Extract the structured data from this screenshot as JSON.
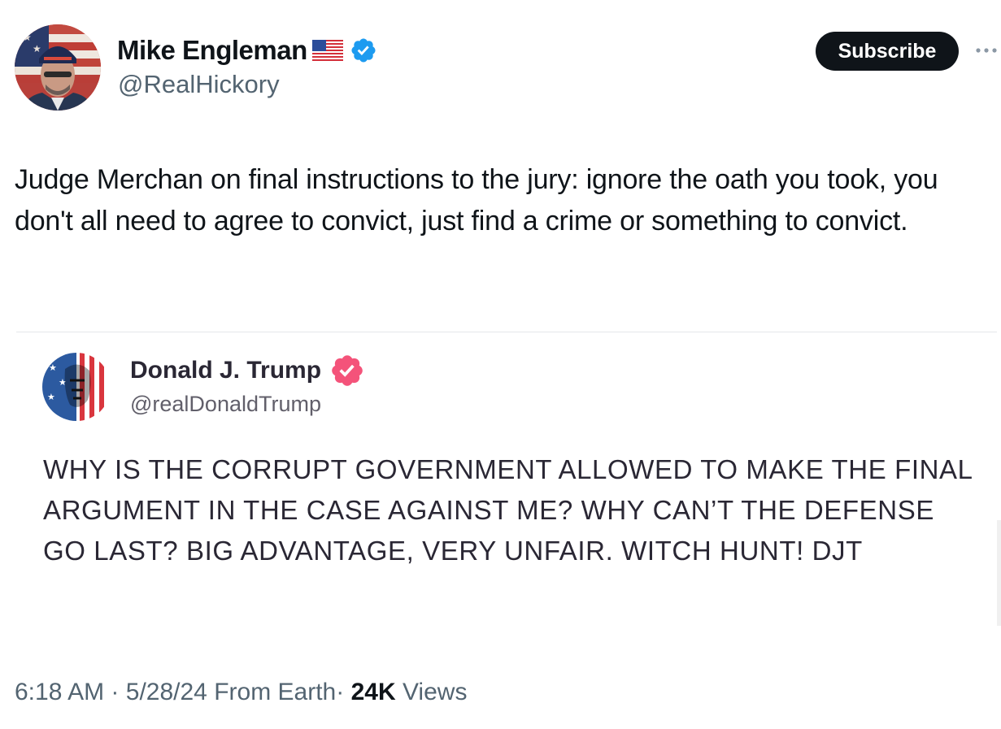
{
  "tweet": {
    "author": {
      "name": "Mike Engleman",
      "handle": "@RealHickory"
    },
    "subscribe_label": "Subscribe",
    "text": "Judge Merchan on final instructions to the jury: ignore the oath you took, you don't all need to agree to convict, just find a crime or something to convict.",
    "meta": {
      "time": "6:18 AM",
      "separator": "·",
      "date": "5/28/24",
      "source": "From Earth",
      "views_count": "24K",
      "views_label": "Views"
    }
  },
  "embedded_post": {
    "author": {
      "name": "Donald J. Trump",
      "handle": "@realDonaldTrump"
    },
    "text": "WHY IS THE CORRUPT GOVERNMENT ALLOWED TO MAKE THE FINAL ARGUMENT IN THE CASE AGAINST ME? WHY CAN’T THE DEFENSE GO LAST? BIG ADVANTAGE, VERY UNFAIR. WITCH HUNT! DJT"
  },
  "icons": {
    "flag": "us-flag-icon",
    "verified": "verified-badge-icon",
    "embed_verified": "pink-verified-badge-icon",
    "more": "more-options-icon"
  },
  "colors": {
    "text_primary": "#0f1419",
    "text_secondary": "#536471",
    "verified_blue": "#1d9bf0",
    "truth_verified_pink": "#f4537a",
    "subscribe_bg": "#0f1419"
  }
}
